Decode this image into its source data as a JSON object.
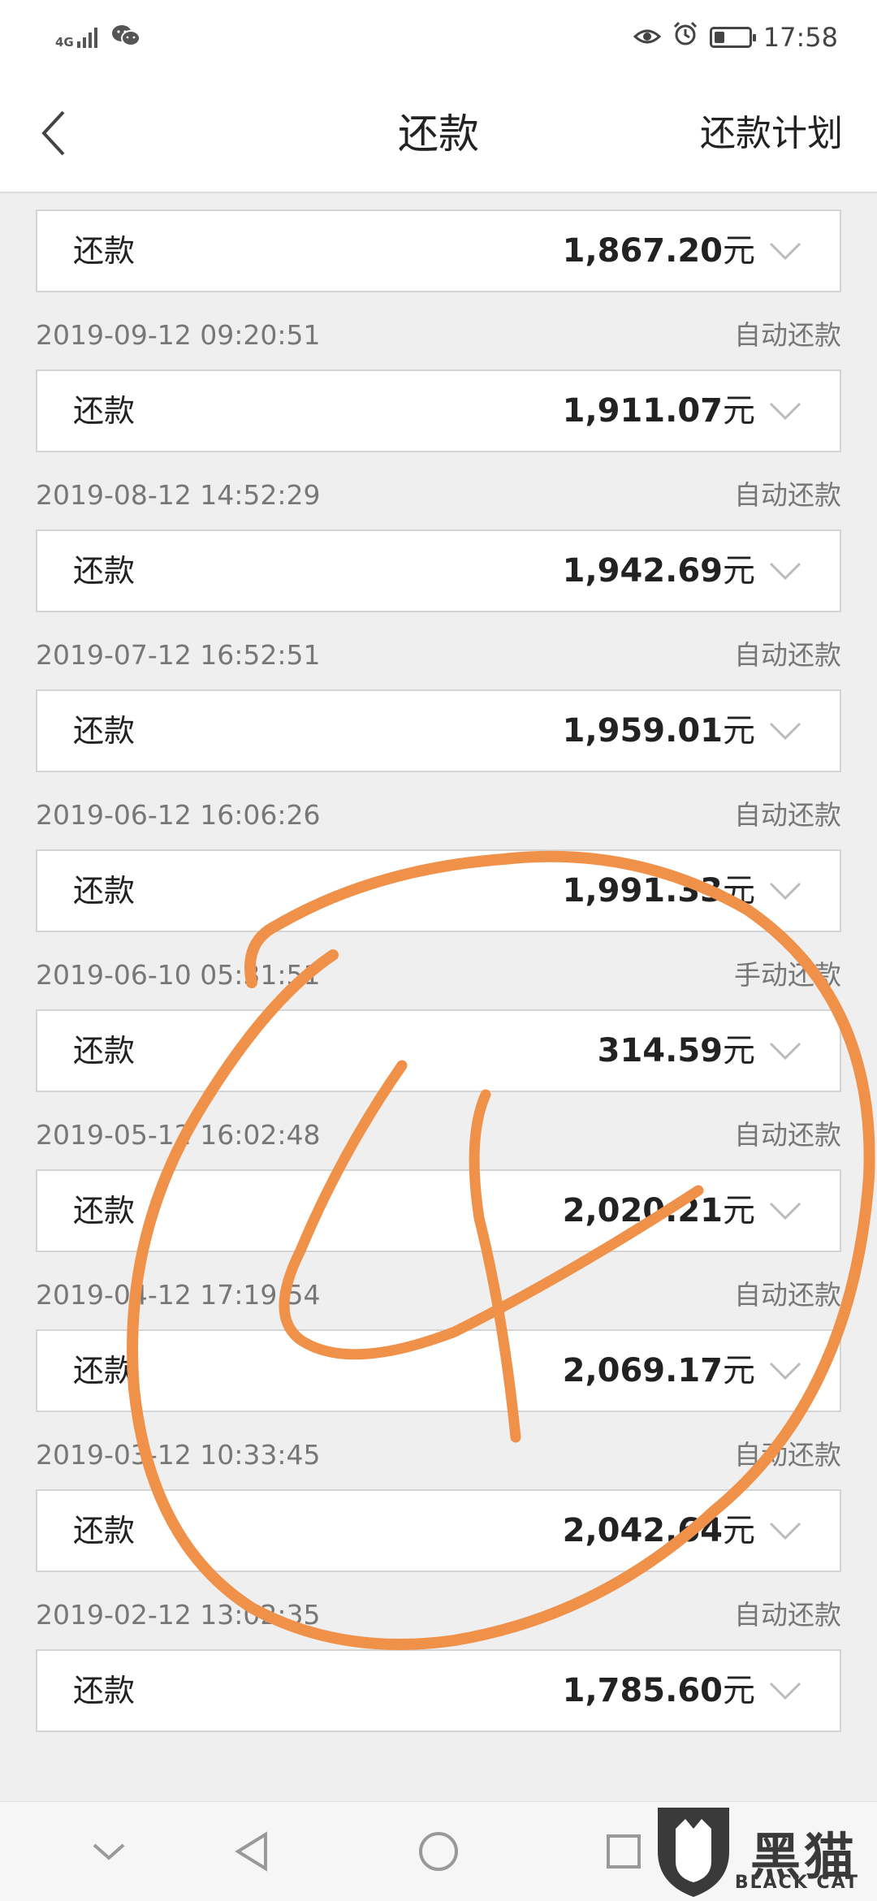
{
  "status_bar": {
    "network": "4G",
    "time": "17:58",
    "battery_level": 0.3,
    "left_icons": [
      "signal-icon",
      "wechat-icon"
    ],
    "right_icons": [
      "eye-icon",
      "alarm-icon",
      "battery-icon"
    ]
  },
  "header": {
    "back_icon": "chevron-left-icon",
    "title": "还款",
    "plan_label": "还款计划"
  },
  "first_card": {
    "label": "还款",
    "amount": "1,867.20",
    "unit": "元"
  },
  "records": [
    {
      "date": "2019-09-12 09:20:51",
      "type": "自动还款",
      "label": "还款",
      "amount": "1,911.07",
      "unit": "元"
    },
    {
      "date": "2019-08-12 14:52:29",
      "type": "自动还款",
      "label": "还款",
      "amount": "1,942.69",
      "unit": "元"
    },
    {
      "date": "2019-07-12 16:52:51",
      "type": "自动还款",
      "label": "还款",
      "amount": "1,959.01",
      "unit": "元"
    },
    {
      "date": "2019-06-12 16:06:26",
      "type": "自动还款",
      "label": "还款",
      "amount": "1,991.33",
      "unit": "元"
    },
    {
      "date": "2019-06-10 05:31:51",
      "type": "手动还款",
      "label": "还款",
      "amount": "314.59",
      "unit": "元"
    },
    {
      "date": "2019-05-12 16:02:48",
      "type": "自动还款",
      "label": "还款",
      "amount": "2,020.21",
      "unit": "元"
    },
    {
      "date": "2019-04-12 17:19:54",
      "type": "自动还款",
      "label": "还款",
      "amount": "2,069.17",
      "unit": "元"
    },
    {
      "date": "2019-03-12 10:33:45",
      "type": "自动还款",
      "label": "还款",
      "amount": "2,042.64",
      "unit": "元"
    },
    {
      "date": "2019-02-12 13:02:35",
      "type": "自动还款",
      "label": "还款",
      "amount": "1,785.60",
      "unit": "元"
    }
  ],
  "nav_bar": {
    "icons": [
      "nav-hide-icon",
      "nav-back-icon",
      "nav-home-icon",
      "nav-recents-icon"
    ]
  },
  "watermark": {
    "text": "黑猫",
    "subtext": "BLACK CAT"
  },
  "annotation": {
    "text": "4",
    "color": "#f0914a"
  }
}
